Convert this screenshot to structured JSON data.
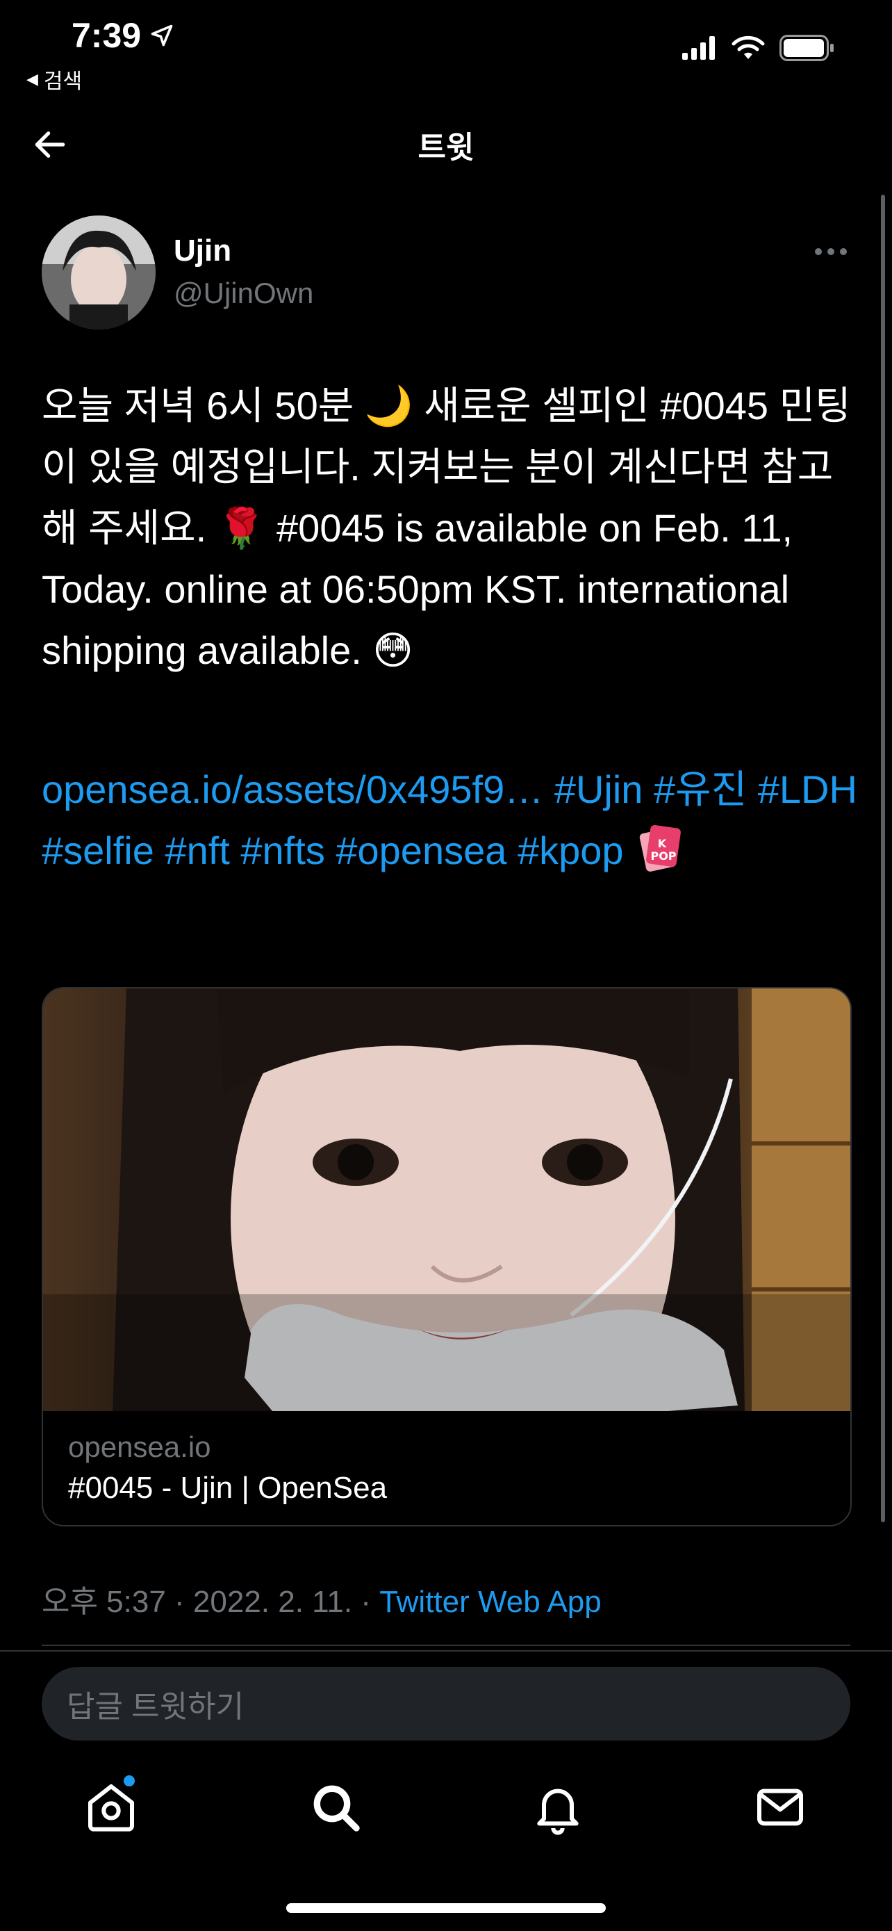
{
  "status_bar": {
    "time": "7:39",
    "back_to_app": "검색"
  },
  "nav": {
    "title": "트윗"
  },
  "tweet": {
    "display_name": "Ujin",
    "handle": "@UjinOwn",
    "text": "오늘 저녁 6시 50분 🌙 새로운 셀피인 #0045 민팅이 있을 예정입니다. 지켜보는 분이 계신다면 참고해 주세요. 🌹 #0045 is available on Feb. 11, Today. online at 06:50pm KST. international shipping available. 😳",
    "link_url": "opensea.io/assets/0x495f9…",
    "hashtags": [
      "#Ujin",
      "#유진",
      "#LDH",
      "#selfie",
      "#nft",
      "#nfts",
      "#opensea",
      "#kpop"
    ],
    "kpop_emoji": "🃏",
    "card": {
      "domain": "opensea.io",
      "title": "#0045 - Ujin | OpenSea"
    },
    "timestamp": "오후 5:37 · 2022. 2. 11. · ",
    "source": "Twitter Web App"
  },
  "reply": {
    "placeholder": "답글 트윗하기"
  },
  "tabs": {
    "icons": [
      "home-icon",
      "search-icon",
      "notifications-icon",
      "messages-icon"
    ]
  },
  "colors": {
    "background": "#000000",
    "link": "#1d9bf0",
    "muted": "#71767b",
    "divider": "#2f3336"
  }
}
